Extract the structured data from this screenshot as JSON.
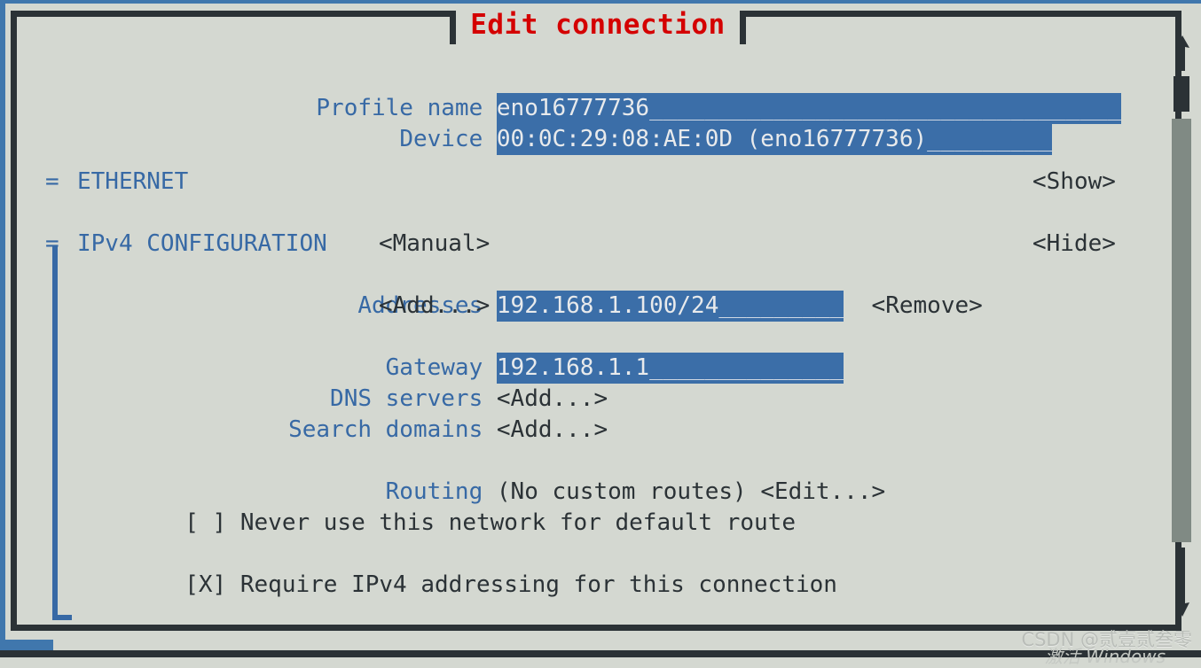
{
  "window": {
    "title": "Edit connection",
    "title_color": "#d40000",
    "background": "#d4d8d1",
    "frame_color": "#2b3236",
    "outer_accent": "#4077ad",
    "highlight_color": "#3b6ea8",
    "label_color": "#3769a5",
    "text_color": "#2b3236"
  },
  "form": {
    "profile_name": {
      "label": "Profile name",
      "value": "eno16777736",
      "fill": "__________________________________"
    },
    "device": {
      "label": "Device",
      "value": "00:0C:29:08:AE:0D (eno16777736)",
      "fill": "_________"
    }
  },
  "sections": [
    {
      "marker": "=",
      "title": "ETHERNET",
      "action": "<Show>"
    },
    {
      "marker": "=",
      "title": "IPv4 CONFIGURATION",
      "method": "<Manual>",
      "action": "<Hide>"
    }
  ],
  "ipv4": {
    "addresses": {
      "label": "Addresses",
      "value": "192.168.1.100/24",
      "fill": "_________",
      "remove_label": "<Remove>",
      "add_label": "<Add...>"
    },
    "gateway": {
      "label": "Gateway",
      "value": "192.168.1.1",
      "fill": "______________"
    },
    "dns_servers": {
      "label": "DNS servers",
      "add_label": "<Add...>"
    },
    "search_domains": {
      "label": "Search domains",
      "add_label": "<Add...>"
    },
    "routing": {
      "label": "Routing",
      "status": "(No custom routes)",
      "edit_label": "<Edit...>"
    },
    "never_default": {
      "checkbox": "[ ]",
      "checked": false,
      "label": "Never use this network for default route"
    },
    "require_ipv4": {
      "checkbox": "[X]",
      "checked": true,
      "label": "Require IPv4 addressing for this connection"
    }
  },
  "scrollbar": {
    "up_arrow": "up-arrow",
    "down_arrow": "down-arrow",
    "thumb_position": "near-top"
  },
  "watermark": {
    "text": "CSDN @贰壹贰叁零",
    "secondary": "激活 Windows"
  }
}
